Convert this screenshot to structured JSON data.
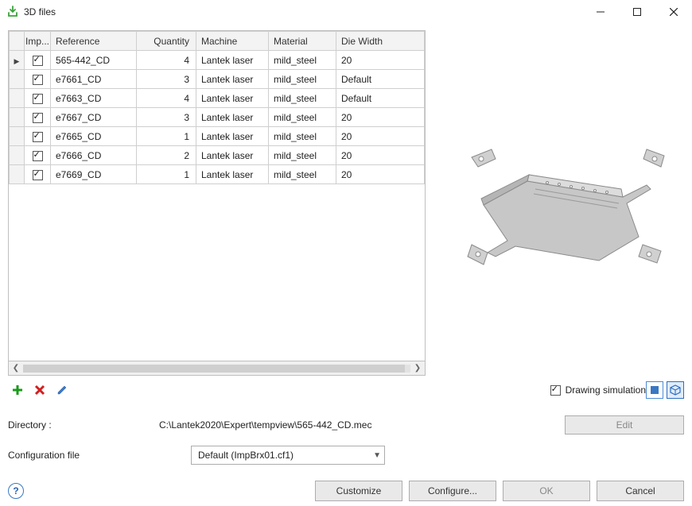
{
  "window": {
    "title": "3D files"
  },
  "grid": {
    "headers": {
      "rowhdr": "",
      "imp": "Imp...",
      "reference": "Reference",
      "quantity": "Quantity",
      "machine": "Machine",
      "material": "Material",
      "die_width": "Die Width"
    },
    "rows": [
      {
        "selected": true,
        "imp": true,
        "reference": "565-442_CD",
        "quantity": 4,
        "machine": "Lantek laser",
        "material": "mild_steel",
        "die_width": "20"
      },
      {
        "selected": false,
        "imp": true,
        "reference": "e7661_CD",
        "quantity": 3,
        "machine": "Lantek laser",
        "material": "mild_steel",
        "die_width": "Default"
      },
      {
        "selected": false,
        "imp": true,
        "reference": "e7663_CD",
        "quantity": 4,
        "machine": "Lantek laser",
        "material": "mild_steel",
        "die_width": "Default"
      },
      {
        "selected": false,
        "imp": true,
        "reference": "e7667_CD",
        "quantity": 3,
        "machine": "Lantek laser",
        "material": "mild_steel",
        "die_width": "20"
      },
      {
        "selected": false,
        "imp": true,
        "reference": "e7665_CD",
        "quantity": 1,
        "machine": "Lantek laser",
        "material": "mild_steel",
        "die_width": "20"
      },
      {
        "selected": false,
        "imp": true,
        "reference": "e7666_CD",
        "quantity": 2,
        "machine": "Lantek laser",
        "material": "mild_steel",
        "die_width": "20"
      },
      {
        "selected": false,
        "imp": true,
        "reference": "e7669_CD",
        "quantity": 1,
        "machine": "Lantek laser",
        "material": "mild_steel",
        "die_width": "20"
      }
    ]
  },
  "drawing_sim": {
    "label": "Drawing simulation",
    "checked": true
  },
  "directory": {
    "label": "Directory :",
    "value": "C:\\Lantek2020\\Expert\\tempview\\565-442_CD.mec",
    "edit_label": "Edit"
  },
  "config_file": {
    "label": "Configuration file",
    "selected": "Default (ImpBrx01.cf1)"
  },
  "buttons": {
    "customize": "Customize",
    "configure": "Configure...",
    "ok": "OK",
    "cancel": "Cancel"
  }
}
